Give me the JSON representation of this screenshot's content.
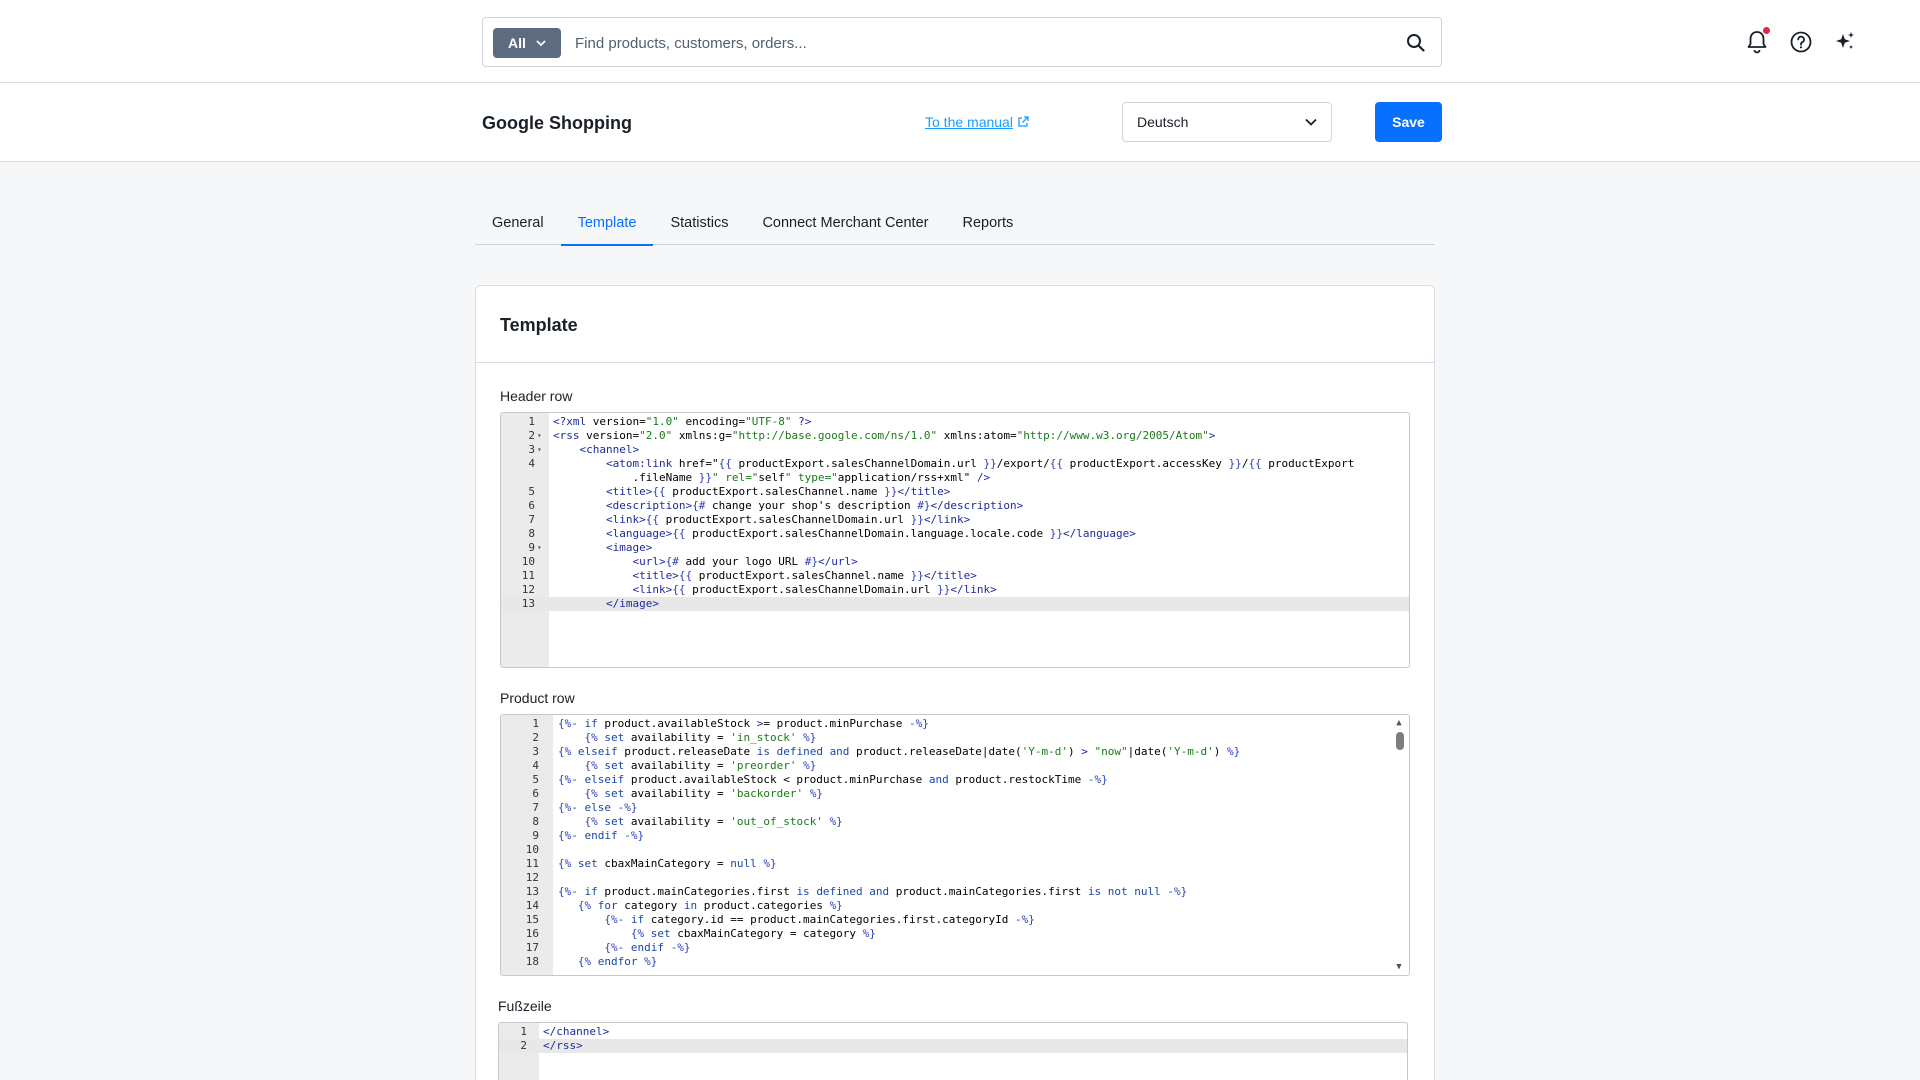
{
  "search": {
    "filter_label": "All",
    "placeholder": "Find products, customers, orders..."
  },
  "header_icons": [
    "bell-icon",
    "help-icon",
    "sparkle-icon"
  ],
  "page": {
    "title": "Google Shopping",
    "manual_link": "To the manual",
    "language": "Deutsch",
    "save_label": "Save"
  },
  "tabs": [
    {
      "label": "General",
      "active": false
    },
    {
      "label": "Template",
      "active": true
    },
    {
      "label": "Statistics",
      "active": false
    },
    {
      "label": "Connect Merchant Center",
      "active": false
    },
    {
      "label": "Reports",
      "active": false
    }
  ],
  "card": {
    "title": "Template",
    "header_row_label": "Header row",
    "product_row_label": "Product row",
    "footer_label": "Fußzeile"
  },
  "header_row_code": [
    "<?xml version=\"1.0\" encoding=\"UTF-8\" ?>",
    "<rss version=\"2.0\" xmlns:g=\"http://base.google.com/ns/1.0\" xmlns:atom=\"http://www.w3.org/2005/Atom\">",
    "    <channel>",
    "        <atom:link href=\"{{ productExport.salesChannelDomain.url }}/export/{{ productExport.accessKey }}/{{ productExport",
    "            .fileName }}\" rel=\"self\" type=\"application/rss+xml\" />",
    "        <title>{{ productExport.salesChannel.name }}</title>",
    "        <description>{# change your shop's description #}</description>",
    "        <link>{{ productExport.salesChannelDomain.url }}</link>",
    "        <language>{{ productExport.salesChannelDomain.language.locale.code }}</language>",
    "        <image>",
    "            <url>{# add your logo URL #}</url>",
    "            <title>{{ productExport.salesChannel.name }}</title>",
    "            <link>{{ productExport.salesChannelDomain.url }}</link>",
    "        </image>"
  ],
  "product_row_code": [
    "{%- if product.availableStock >= product.minPurchase -%}",
    "    {% set availability = 'in_stock' %}",
    "{% elseif product.releaseDate is defined and product.releaseDate|date('Y-m-d') > \"now\"|date('Y-m-d') %}",
    "    {% set availability = 'preorder' %}",
    "{%- elseif product.availableStock < product.minPurchase and product.restockTime -%}",
    "    {% set availability = 'backorder' %}",
    "{%- else -%}",
    "    {% set availability = 'out_of_stock' %}",
    "{%- endif -%}",
    "",
    "{% set cbaxMainCategory = null %}",
    "",
    "{%- if product.mainCategories.first is defined and product.mainCategories.first is not null -%}",
    "   {% for category in product.categories %}",
    "       {%- if category.id == product.mainCategories.first.categoryId -%}",
    "           {% set cbaxMainCategory = category %}",
    "       {%- endif -%}",
    "   {% endfor %}"
  ],
  "footer_code": [
    "</channel>",
    "</rss>"
  ]
}
